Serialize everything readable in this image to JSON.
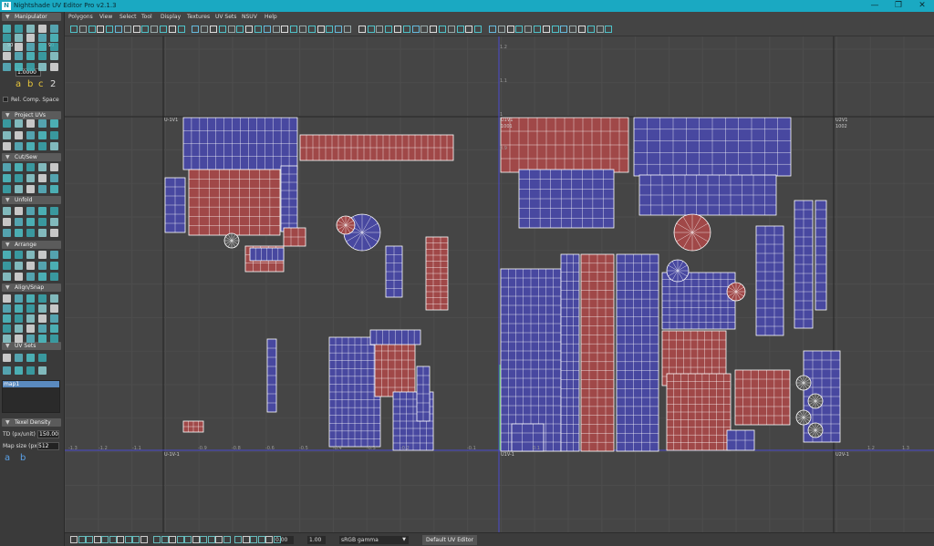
{
  "window": {
    "title": "Nightshade UV Editor Pro v2.1.3",
    "logo": "N",
    "minimize": "—",
    "restore": "❐",
    "close": "✕"
  },
  "menu": [
    "Polygons",
    "View",
    "Select",
    "Tool",
    "Display",
    "Textures",
    "UV Sets",
    "NSUV",
    "Help"
  ],
  "sidebar": {
    "manipulator": {
      "title": "Manipulator",
      "rotate_labels": [
        "90",
        "90"
      ],
      "step_value": "1.0000",
      "letters": [
        "a",
        "b",
        "c",
        "2"
      ],
      "rel_space": "Rel. Comp. Space"
    },
    "sections": [
      "Project UVs",
      "Cut/Sew",
      "Unfold",
      "Arrange",
      "Align/Snap",
      "UV Sets"
    ],
    "uv_set_list": [
      "map1"
    ],
    "texel_density": {
      "title": "Texel Density",
      "td_label": "TD (px/unit)",
      "td_value": "150.00",
      "map_label": "Map size (px)",
      "map_value": "512",
      "bottom_letters": [
        "a",
        "b"
      ]
    }
  },
  "viewport": {
    "tile_labels": {
      "u_1_v1": "U-1V1",
      "u1v1": "U1V1",
      "u1v1_id": "1001",
      "u2v1": "U2V1",
      "u2v1_id": "1002",
      "u_1_v_1": "U-1V-1",
      "u1v_1": "U1V-1",
      "u2v_1": "U2V-1"
    },
    "ruler_x": [
      "-1.3",
      "-1.2",
      "-1.1",
      "-0.9",
      "-0.8",
      "-0.6",
      "-0.5",
      "-0.4",
      "-0.3",
      "-0.2",
      "-0.1",
      "0.1",
      "1.2",
      "1.3"
    ],
    "ruler_y": [
      "1.2",
      "1.1",
      "1",
      "0.9"
    ],
    "colors": {
      "red": "#a04848",
      "blue": "#4848a0",
      "background": "#454545",
      "v_axis": "#4a4ad0",
      "wire": "#ffffff"
    }
  },
  "status": {
    "value1": "0.00",
    "value2": "1.00",
    "color_space": "sRGB gamma",
    "mode": "Default UV Editor"
  }
}
